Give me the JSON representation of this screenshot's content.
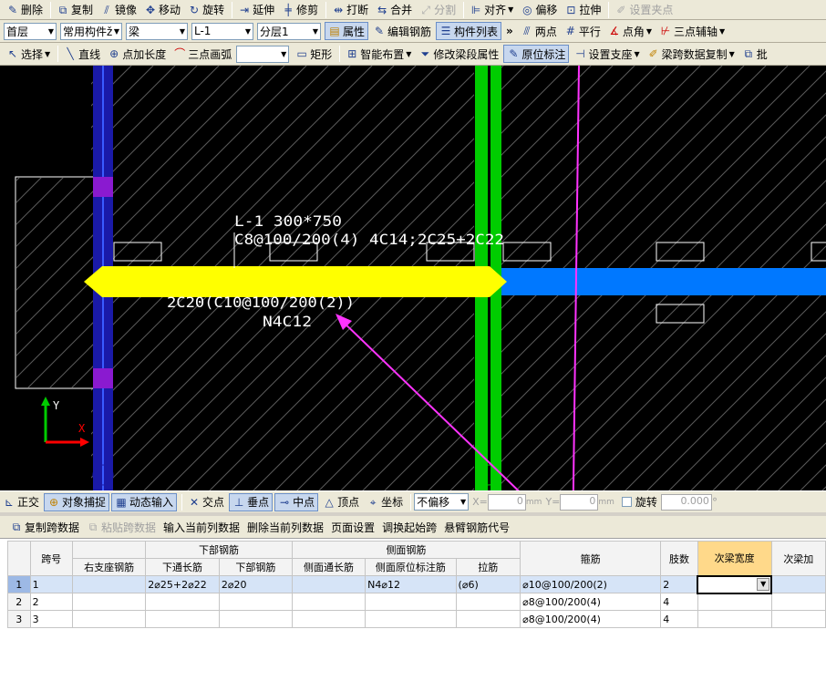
{
  "toolbar1": {
    "items": [
      {
        "icon": "erase-icon",
        "label": "删除"
      },
      {
        "icon": "copy-icon",
        "label": "复制"
      },
      {
        "icon": "mirror-icon",
        "label": "镜像"
      },
      {
        "icon": "move-icon",
        "label": "移动"
      },
      {
        "icon": "rotate-icon",
        "label": "旋转"
      },
      {
        "icon": "extend-icon",
        "label": "延伸"
      },
      {
        "icon": "trim-icon",
        "label": "修剪"
      },
      {
        "icon": "break-icon",
        "label": "打断"
      },
      {
        "icon": "merge-icon",
        "label": "合并"
      },
      {
        "icon": "split-icon",
        "label": "分割"
      },
      {
        "icon": "align-icon",
        "label": "对齐"
      },
      {
        "icon": "offset-icon",
        "label": "偏移"
      },
      {
        "icon": "stretch-icon",
        "label": "拉伸"
      },
      {
        "icon": "grip-icon",
        "label": "设置夹点"
      }
    ]
  },
  "toolbar2": {
    "floor": "首层",
    "component_type": "常用构件ž",
    "category": "梁",
    "component": "L-1",
    "layer": "分层1",
    "properties": "属性",
    "edit_rebar": "编辑钢筋",
    "component_list": "构件列表",
    "more": "»",
    "two_points": "两点",
    "parallel": "平行",
    "point_angle": "点角",
    "three_point_axis": "三点辅轴"
  },
  "toolbar3": {
    "select": "选择",
    "line": "直线",
    "point_length": "点加长度",
    "three_point_arc": "三点画弧",
    "shape_combo": "",
    "rect": "矩形",
    "smart_layout": "智能布置",
    "modify_span_props": "修改梁段属性",
    "in_situ_label": "原位标注",
    "set_support": "设置支座",
    "copy_span_data": "梁跨数据复制",
    "batch": "批"
  },
  "canvas": {
    "beam_label_line1": "L-1 300*750",
    "beam_label_line2": "C8@100/200(4) 4C14;2C25+2C22",
    "bottom_label_line1": "2C20(C10@100/200(2))",
    "bottom_label_line2": "N4C12",
    "axis_y": "Y",
    "axis_x": "X",
    "colors": {
      "beam_yellow": "#ffff00",
      "beam_blue": "#0078ff",
      "column_green": "#00cc00",
      "column_blue": "#1a1aa8",
      "pointer_magenta": "#ff33ff"
    }
  },
  "statusbar": {
    "ortho": "正交",
    "object_snap": "对象捕捉",
    "dynamic_input": "动态输入",
    "intersection": "交点",
    "perpendicular": "垂点",
    "midpoint": "中点",
    "vertex": "顶点",
    "coordinate": "坐标",
    "offset_mode": "不偏移",
    "x_label": "X=",
    "x_value": "0",
    "x_unit": "mm",
    "y_label": "Y=",
    "y_value": "0",
    "y_unit": "mm",
    "rotate": "旋转",
    "rotate_value": "0.000",
    "degree": "°"
  },
  "grid_toolbar": {
    "copy_span": "复制跨数据",
    "paste_span": "粘贴跨数据",
    "input_column": "输入当前列数据",
    "delete_column": "删除当前列数据",
    "page_setup": "页面设置",
    "swap_start": "调换起始跨",
    "cantilever_code": "悬臂钢筋代号"
  },
  "grid": {
    "group_headers": {
      "bottom_rebar": "下部钢筋",
      "side_rebar": "侧面钢筋"
    },
    "columns": [
      "跨号",
      "右支座钢筋",
      "下通长筋",
      "下部钢筋",
      "侧面通长筋",
      "侧面原位标注筋",
      "拉筋",
      "箍筋",
      "肢数",
      "次梁宽度",
      "次梁加"
    ],
    "rows": [
      {
        "num": "1",
        "span": "1",
        "right_support": "",
        "bottom_through": "2⌀25+2⌀22",
        "bottom": "2⌀20",
        "side_through": "",
        "side_insitu": "N4⌀12",
        "tie": "(⌀6)",
        "stirrup": "⌀10@100/200(2)",
        "legs": "2",
        "sub_width": "",
        "sub_add": ""
      },
      {
        "num": "2",
        "span": "2",
        "right_support": "",
        "bottom_through": "",
        "bottom": "",
        "side_through": "",
        "side_insitu": "",
        "tie": "",
        "stirrup": "⌀8@100/200(4)",
        "legs": "4",
        "sub_width": "",
        "sub_add": ""
      },
      {
        "num": "3",
        "span": "3",
        "right_support": "",
        "bottom_through": "",
        "bottom": "",
        "side_through": "",
        "side_insitu": "",
        "tie": "",
        "stirrup": "⌀8@100/200(4)",
        "legs": "4",
        "sub_width": "",
        "sub_add": ""
      }
    ]
  }
}
